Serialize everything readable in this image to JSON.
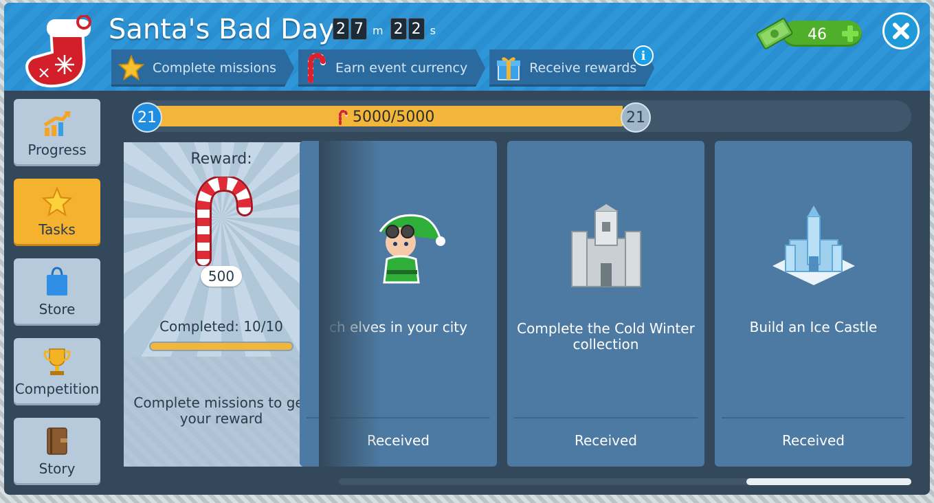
{
  "event": {
    "title": "Santa's Bad Day",
    "timer": {
      "d1": "2",
      "d2": "7",
      "unit1": "m",
      "d3": "2",
      "d4": "2",
      "unit2": "s"
    }
  },
  "steps": [
    {
      "label": "Complete missions",
      "icon": "star-icon"
    },
    {
      "label": "Earn event currency",
      "icon": "candy-cane-icon"
    },
    {
      "label": "Receive rewards",
      "icon": "gift-icon"
    }
  ],
  "currency": {
    "amount": "46",
    "icon": "cash-icon"
  },
  "sidebar": {
    "items": [
      {
        "label": "Progress",
        "icon": "chart-arrow-icon",
        "active": false
      },
      {
        "label": "Tasks",
        "icon": "star-icon",
        "active": true
      },
      {
        "label": "Store",
        "icon": "shopping-bag-icon",
        "active": false
      },
      {
        "label": "Competition",
        "icon": "trophy-icon",
        "active": false
      },
      {
        "label": "Story",
        "icon": "book-icon",
        "active": false
      }
    ]
  },
  "progress": {
    "level_left": "21",
    "level_right": "21",
    "text": "5000/5000",
    "fraction": 1.0
  },
  "reward": {
    "label": "Reward:",
    "quantity": "500",
    "completed": "Completed: 10/10",
    "completed_fraction": 1.0,
    "description": "Complete missions to get your reward"
  },
  "tasks": [
    {
      "description": "ch elves in your city",
      "status": "Received",
      "art": "elf-icon"
    },
    {
      "description": "Complete the Cold Winter collection",
      "status": "Received",
      "art": "stone-castle-icon"
    },
    {
      "description": "Build an Ice Castle",
      "status": "Received",
      "art": "ice-castle-icon"
    }
  ],
  "colors": {
    "accent": "#f5b22e",
    "header": "#2a8fd0",
    "card": "#4d7aa2",
    "panel": "#33485b"
  }
}
